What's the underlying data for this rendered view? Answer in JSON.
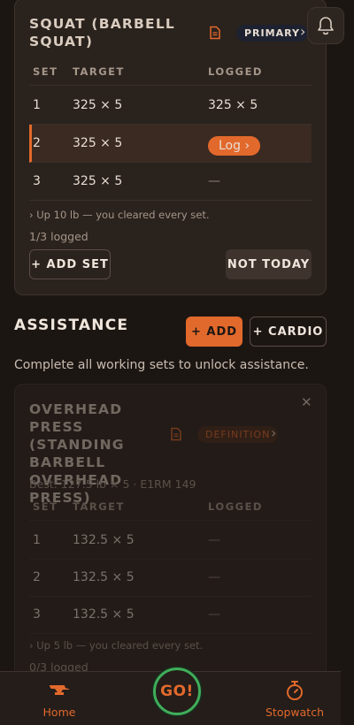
{
  "primary_exercise": {
    "title": "SQUAT (BARBELL SQUAT)",
    "badge": "PRIMARY",
    "columns": [
      "SET",
      "TARGET",
      "LOGGED"
    ],
    "sets": [
      {
        "set": "1",
        "target": "325 × 5",
        "logged": "325 × 5"
      },
      {
        "set": "2",
        "target": "325 × 5",
        "logged": "Log ›"
      },
      {
        "set": "3",
        "target": "325 × 5",
        "logged": "—"
      }
    ],
    "hint": "›  Up 10 lb — you cleared every set.",
    "count": "1/3 logged",
    "add_set": "+ ADD SET",
    "not_today": "NOT TODAY"
  },
  "assistance": {
    "title": "ASSISTANCE",
    "add": "+ ADD",
    "cardio": "+ CARDIO",
    "subtitle": "Complete all working sets to unlock assistance."
  },
  "locked_exercise": {
    "title": "OVERHEAD PRESS (STANDING BARBELL OVERHEAD PRESS)",
    "badge": "DEFINITION",
    "best": "Best: 127.5 lb × 5 · E1RM 149",
    "columns": [
      "SET",
      "TARGET",
      "LOGGED"
    ],
    "sets": [
      {
        "set": "1",
        "target": "132.5 × 5",
        "logged": "—"
      },
      {
        "set": "2",
        "target": "132.5 × 5",
        "logged": "—"
      },
      {
        "set": "3",
        "target": "132.5 × 5",
        "logged": "—"
      }
    ],
    "hint": "›  Up 5 lb — you cleared every set.",
    "count": "0/3 logged"
  },
  "tabbar": {
    "home": "Home",
    "go": "GO!",
    "stopwatch": "Stopwatch"
  },
  "colors": {
    "accent": "#e2692c",
    "background": "#1c1613",
    "card": "#2a221d",
    "go_ring": "#3fae5a"
  }
}
